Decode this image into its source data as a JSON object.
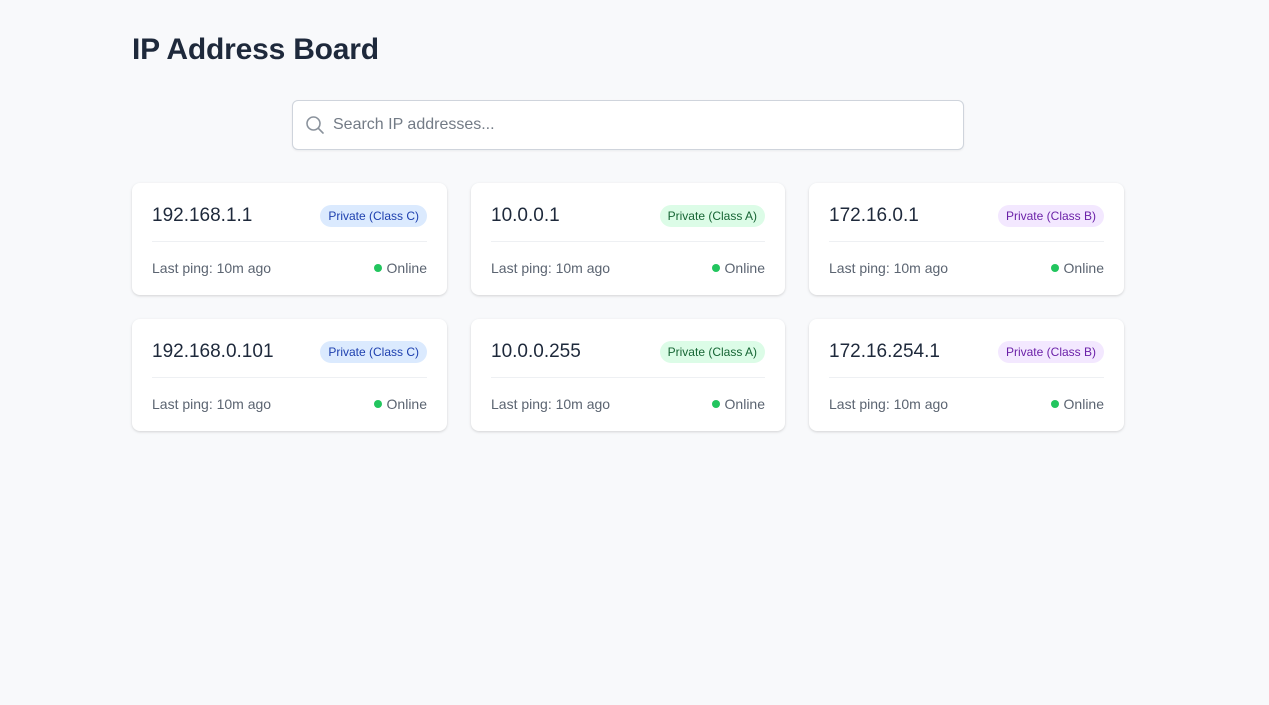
{
  "header": {
    "title": "IP Address Board"
  },
  "search": {
    "placeholder": "Search IP addresses..."
  },
  "colors": {
    "online": "#22c55e",
    "class_c_bg": "#dbeafe",
    "class_c_fg": "#1e40af",
    "class_a_bg": "#dcfce7",
    "class_a_fg": "#166534",
    "class_b_bg": "#f3e8ff",
    "class_b_fg": "#6b21a8"
  },
  "cards": [
    {
      "ip": "192.168.1.1",
      "badge": "Private (Class C)",
      "ping": "Last ping: 10m ago",
      "status": "Online"
    },
    {
      "ip": "10.0.0.1",
      "badge": "Private (Class A)",
      "ping": "Last ping: 10m ago",
      "status": "Online"
    },
    {
      "ip": "172.16.0.1",
      "badge": "Private (Class B)",
      "ping": "Last ping: 10m ago",
      "status": "Online"
    },
    {
      "ip": "192.168.0.101",
      "badge": "Private (Class C)",
      "ping": "Last ping: 10m ago",
      "status": "Online"
    },
    {
      "ip": "10.0.0.255",
      "badge": "Private (Class A)",
      "ping": "Last ping: 10m ago",
      "status": "Online"
    },
    {
      "ip": "172.16.254.1",
      "badge": "Private (Class B)",
      "ping": "Last ping: 10m ago",
      "status": "Online"
    }
  ]
}
